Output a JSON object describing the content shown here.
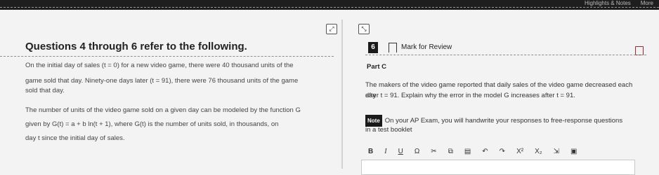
{
  "header": {
    "links": [
      "Highlights & Notes",
      "More"
    ]
  },
  "left": {
    "heading": "Questions 4 through 6 refer to the following.",
    "paragraphs": [
      "On the initial day of sales (t = 0) for a new video game, there were 40 thousand units of the",
      "game sold that day. Ninety-one days later (t = 91), there were 76 thousand units of the game",
      "sold that day.",
      "The number of units of the video game sold on a given day can be modeled by the function G",
      "given by G(t) = a + b ln(t + 1), where G(t) is the number of units sold, in thousands, on",
      "day t since the initial day of sales."
    ]
  },
  "right": {
    "question_number": "6",
    "mark_for_review": "Mark for Review",
    "part": "Part C",
    "prompt_line1": "The makers of the video game reported that daily sales of the video game decreased each day",
    "prompt_line2": "after t = 91. Explain why the error in the model G increases after t = 91.",
    "note_label": "Note",
    "note_text": "On your AP Exam, you will handwrite your responses to free-response questions",
    "note_text2": "in a test booklet"
  },
  "toolbar": {
    "bold": "B",
    "italic": "I",
    "underline": "U",
    "omega": "Ω",
    "cut": "✂",
    "superscript": "X²",
    "subscript": "X₂"
  }
}
